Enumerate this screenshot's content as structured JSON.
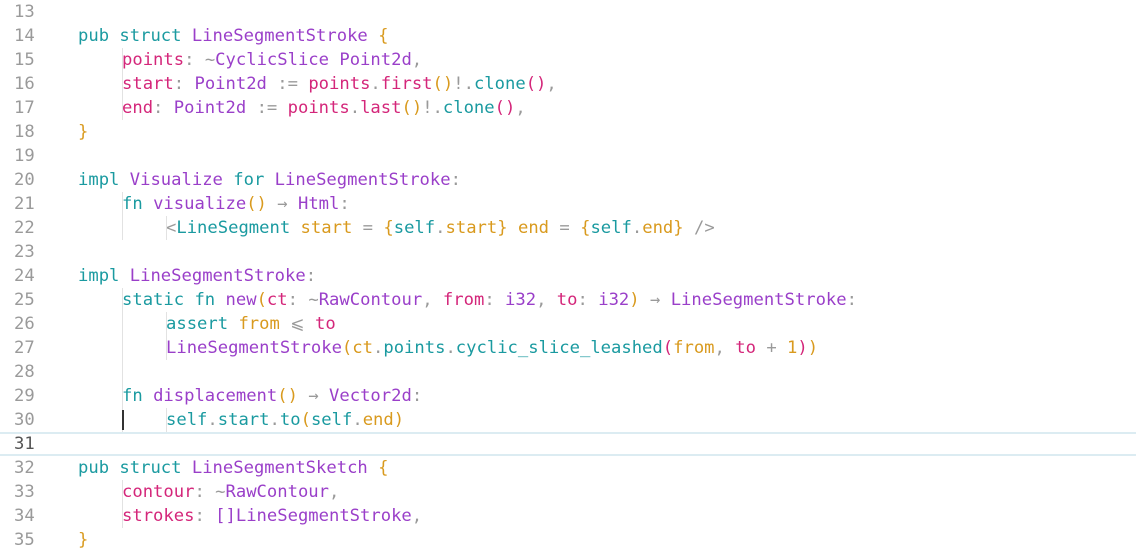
{
  "editor": {
    "current_line": 31,
    "colors": {
      "keyword": "#1a9aa0",
      "type": "#9a3fc9",
      "field": "#d4267a",
      "punctuation": "#d99a1e",
      "operator": "#9a9a9a",
      "gutter": "#9a9a9a",
      "current_line_border": "#dcecf2"
    },
    "lines": [
      {
        "num": "13",
        "indent": 0,
        "tokens": []
      },
      {
        "num": "14",
        "indent": 0,
        "tokens": [
          {
            "t": "kw",
            "s": "pub"
          },
          {
            "t": "sp",
            "s": " "
          },
          {
            "t": "kw",
            "s": "struct"
          },
          {
            "t": "sp",
            "s": " "
          },
          {
            "t": "type",
            "s": "LineSegmentStroke"
          },
          {
            "t": "sp",
            "s": " "
          },
          {
            "t": "pun",
            "s": "{"
          }
        ]
      },
      {
        "num": "15",
        "indent": 1,
        "tokens": [
          {
            "t": "fld",
            "s": "points"
          },
          {
            "t": "op",
            "s": ":"
          },
          {
            "t": "sp",
            "s": " "
          },
          {
            "t": "op",
            "s": "~"
          },
          {
            "t": "type",
            "s": "CyclicSlice"
          },
          {
            "t": "sp",
            "s": " "
          },
          {
            "t": "type",
            "s": "Point2d"
          },
          {
            "t": "op",
            "s": ","
          }
        ]
      },
      {
        "num": "16",
        "indent": 1,
        "tokens": [
          {
            "t": "fld",
            "s": "start"
          },
          {
            "t": "op",
            "s": ":"
          },
          {
            "t": "sp",
            "s": " "
          },
          {
            "t": "type",
            "s": "Point2d"
          },
          {
            "t": "sp",
            "s": " "
          },
          {
            "t": "op",
            "s": ":="
          },
          {
            "t": "sp",
            "s": " "
          },
          {
            "t": "fld",
            "s": "points"
          },
          {
            "t": "op",
            "s": "."
          },
          {
            "t": "fld",
            "s": "first"
          },
          {
            "t": "pun",
            "s": "()"
          },
          {
            "t": "op",
            "s": "!."
          },
          {
            "t": "fn",
            "s": "clone"
          },
          {
            "t": "fld",
            "s": "()"
          },
          {
            "t": "op",
            "s": ","
          }
        ]
      },
      {
        "num": "17",
        "indent": 1,
        "tokens": [
          {
            "t": "fld",
            "s": "end"
          },
          {
            "t": "op",
            "s": ":"
          },
          {
            "t": "sp",
            "s": " "
          },
          {
            "t": "type",
            "s": "Point2d"
          },
          {
            "t": "sp",
            "s": " "
          },
          {
            "t": "op",
            "s": ":="
          },
          {
            "t": "sp",
            "s": " "
          },
          {
            "t": "fld",
            "s": "points"
          },
          {
            "t": "op",
            "s": "."
          },
          {
            "t": "fld",
            "s": "last"
          },
          {
            "t": "pun",
            "s": "()"
          },
          {
            "t": "op",
            "s": "!."
          },
          {
            "t": "fn",
            "s": "clone"
          },
          {
            "t": "fld",
            "s": "()"
          },
          {
            "t": "op",
            "s": ","
          }
        ]
      },
      {
        "num": "18",
        "indent": 0,
        "tokens": [
          {
            "t": "pun",
            "s": "}"
          }
        ]
      },
      {
        "num": "19",
        "indent": 0,
        "tokens": []
      },
      {
        "num": "20",
        "indent": 0,
        "tokens": [
          {
            "t": "kw",
            "s": "impl"
          },
          {
            "t": "sp",
            "s": " "
          },
          {
            "t": "type",
            "s": "Visualize"
          },
          {
            "t": "sp",
            "s": " "
          },
          {
            "t": "kw",
            "s": "for"
          },
          {
            "t": "sp",
            "s": " "
          },
          {
            "t": "type",
            "s": "LineSegmentStroke"
          },
          {
            "t": "op",
            "s": ":"
          }
        ]
      },
      {
        "num": "21",
        "indent": 1,
        "tokens": [
          {
            "t": "kw",
            "s": "fn"
          },
          {
            "t": "sp",
            "s": " "
          },
          {
            "t": "type",
            "s": "visualize"
          },
          {
            "t": "pun",
            "s": "()"
          },
          {
            "t": "sp",
            "s": " "
          },
          {
            "t": "op",
            "s": "→"
          },
          {
            "t": "sp",
            "s": " "
          },
          {
            "t": "type",
            "s": "Html"
          },
          {
            "t": "op",
            "s": ":"
          }
        ]
      },
      {
        "num": "22",
        "indent": 2,
        "tokens": [
          {
            "t": "op",
            "s": "<"
          },
          {
            "t": "kw",
            "s": "LineSegment"
          },
          {
            "t": "sp",
            "s": " "
          },
          {
            "t": "pun",
            "s": "start"
          },
          {
            "t": "sp",
            "s": " "
          },
          {
            "t": "op",
            "s": "="
          },
          {
            "t": "sp",
            "s": " "
          },
          {
            "t": "pun",
            "s": "{"
          },
          {
            "t": "kw",
            "s": "self"
          },
          {
            "t": "op",
            "s": "."
          },
          {
            "t": "pun",
            "s": "start"
          },
          {
            "t": "pun",
            "s": "}"
          },
          {
            "t": "sp",
            "s": " "
          },
          {
            "t": "pun",
            "s": "end"
          },
          {
            "t": "sp",
            "s": " "
          },
          {
            "t": "op",
            "s": "="
          },
          {
            "t": "sp",
            "s": " "
          },
          {
            "t": "pun",
            "s": "{"
          },
          {
            "t": "kw",
            "s": "self"
          },
          {
            "t": "op",
            "s": "."
          },
          {
            "t": "pun",
            "s": "end"
          },
          {
            "t": "pun",
            "s": "}"
          },
          {
            "t": "sp",
            "s": " "
          },
          {
            "t": "op",
            "s": "/>"
          }
        ]
      },
      {
        "num": "23",
        "indent": 0,
        "tokens": []
      },
      {
        "num": "24",
        "indent": 0,
        "tokens": [
          {
            "t": "kw",
            "s": "impl"
          },
          {
            "t": "sp",
            "s": " "
          },
          {
            "t": "type",
            "s": "LineSegmentStroke"
          },
          {
            "t": "op",
            "s": ":"
          }
        ]
      },
      {
        "num": "25",
        "indent": 1,
        "tokens": [
          {
            "t": "kw",
            "s": "static"
          },
          {
            "t": "sp",
            "s": " "
          },
          {
            "t": "kw",
            "s": "fn"
          },
          {
            "t": "sp",
            "s": " "
          },
          {
            "t": "type",
            "s": "new"
          },
          {
            "t": "pun",
            "s": "("
          },
          {
            "t": "fld",
            "s": "ct"
          },
          {
            "t": "op",
            "s": ":"
          },
          {
            "t": "sp",
            "s": " "
          },
          {
            "t": "op",
            "s": "~"
          },
          {
            "t": "type",
            "s": "RawContour"
          },
          {
            "t": "op",
            "s": ","
          },
          {
            "t": "sp",
            "s": " "
          },
          {
            "t": "fld",
            "s": "from"
          },
          {
            "t": "op",
            "s": ":"
          },
          {
            "t": "sp",
            "s": " "
          },
          {
            "t": "type",
            "s": "i32"
          },
          {
            "t": "op",
            "s": ","
          },
          {
            "t": "sp",
            "s": " "
          },
          {
            "t": "fld",
            "s": "to"
          },
          {
            "t": "op",
            "s": ":"
          },
          {
            "t": "sp",
            "s": " "
          },
          {
            "t": "type",
            "s": "i32"
          },
          {
            "t": "pun",
            "s": ")"
          },
          {
            "t": "sp",
            "s": " "
          },
          {
            "t": "op",
            "s": "→"
          },
          {
            "t": "sp",
            "s": " "
          },
          {
            "t": "type",
            "s": "LineSegmentStroke"
          },
          {
            "t": "op",
            "s": ":"
          }
        ]
      },
      {
        "num": "26",
        "indent": 2,
        "tokens": [
          {
            "t": "kw",
            "s": "assert"
          },
          {
            "t": "sp",
            "s": " "
          },
          {
            "t": "pun",
            "s": "from"
          },
          {
            "t": "sp",
            "s": " "
          },
          {
            "t": "op",
            "s": "⩽"
          },
          {
            "t": "sp",
            "s": " "
          },
          {
            "t": "fld",
            "s": "to"
          }
        ]
      },
      {
        "num": "27",
        "indent": 2,
        "tokens": [
          {
            "t": "type",
            "s": "LineSegmentStroke"
          },
          {
            "t": "pun",
            "s": "("
          },
          {
            "t": "pun",
            "s": "ct"
          },
          {
            "t": "op",
            "s": "."
          },
          {
            "t": "kw",
            "s": "points"
          },
          {
            "t": "op",
            "s": "."
          },
          {
            "t": "kw",
            "s": "cyclic_slice_leashed"
          },
          {
            "t": "fld",
            "s": "("
          },
          {
            "t": "pun",
            "s": "from"
          },
          {
            "t": "op",
            "s": ","
          },
          {
            "t": "sp",
            "s": " "
          },
          {
            "t": "fld",
            "s": "to"
          },
          {
            "t": "sp",
            "s": " "
          },
          {
            "t": "op",
            "s": "+"
          },
          {
            "t": "sp",
            "s": " "
          },
          {
            "t": "num",
            "s": "1"
          },
          {
            "t": "fld",
            "s": ")"
          },
          {
            "t": "pun",
            "s": ")"
          }
        ]
      },
      {
        "num": "28",
        "indent": 0,
        "tokens": []
      },
      {
        "num": "29",
        "indent": 1,
        "tokens": [
          {
            "t": "kw",
            "s": "fn"
          },
          {
            "t": "sp",
            "s": " "
          },
          {
            "t": "type",
            "s": "displacement"
          },
          {
            "t": "pun",
            "s": "()"
          },
          {
            "t": "sp",
            "s": " "
          },
          {
            "t": "op",
            "s": "→"
          },
          {
            "t": "sp",
            "s": " "
          },
          {
            "t": "type",
            "s": "Vector2d"
          },
          {
            "t": "op",
            "s": ":"
          }
        ]
      },
      {
        "num": "30",
        "indent": 2,
        "tokens": [
          {
            "t": "kw",
            "s": "self"
          },
          {
            "t": "op",
            "s": "."
          },
          {
            "t": "kw",
            "s": "start"
          },
          {
            "t": "op",
            "s": "."
          },
          {
            "t": "kw",
            "s": "to"
          },
          {
            "t": "pun",
            "s": "("
          },
          {
            "t": "kw",
            "s": "self"
          },
          {
            "t": "op",
            "s": "."
          },
          {
            "t": "pun",
            "s": "end"
          },
          {
            "t": "pun",
            "s": ")"
          }
        ]
      },
      {
        "num": "31",
        "indent": 0,
        "tokens": []
      },
      {
        "num": "32",
        "indent": 0,
        "tokens": [
          {
            "t": "kw",
            "s": "pub"
          },
          {
            "t": "sp",
            "s": " "
          },
          {
            "t": "kw",
            "s": "struct"
          },
          {
            "t": "sp",
            "s": " "
          },
          {
            "t": "type",
            "s": "LineSegmentSketch"
          },
          {
            "t": "sp",
            "s": " "
          },
          {
            "t": "pun",
            "s": "{"
          }
        ]
      },
      {
        "num": "33",
        "indent": 1,
        "tokens": [
          {
            "t": "fld",
            "s": "contour"
          },
          {
            "t": "op",
            "s": ":"
          },
          {
            "t": "sp",
            "s": " "
          },
          {
            "t": "op",
            "s": "~"
          },
          {
            "t": "type",
            "s": "RawContour"
          },
          {
            "t": "op",
            "s": ","
          }
        ]
      },
      {
        "num": "34",
        "indent": 1,
        "tokens": [
          {
            "t": "fld",
            "s": "strokes"
          },
          {
            "t": "op",
            "s": ":"
          },
          {
            "t": "sp",
            "s": " "
          },
          {
            "t": "type",
            "s": "[]"
          },
          {
            "t": "type",
            "s": "LineSegmentStroke"
          },
          {
            "t": "op",
            "s": ","
          }
        ]
      },
      {
        "num": "35",
        "indent": 0,
        "tokens": [
          {
            "t": "pun",
            "s": "}"
          }
        ]
      }
    ]
  }
}
